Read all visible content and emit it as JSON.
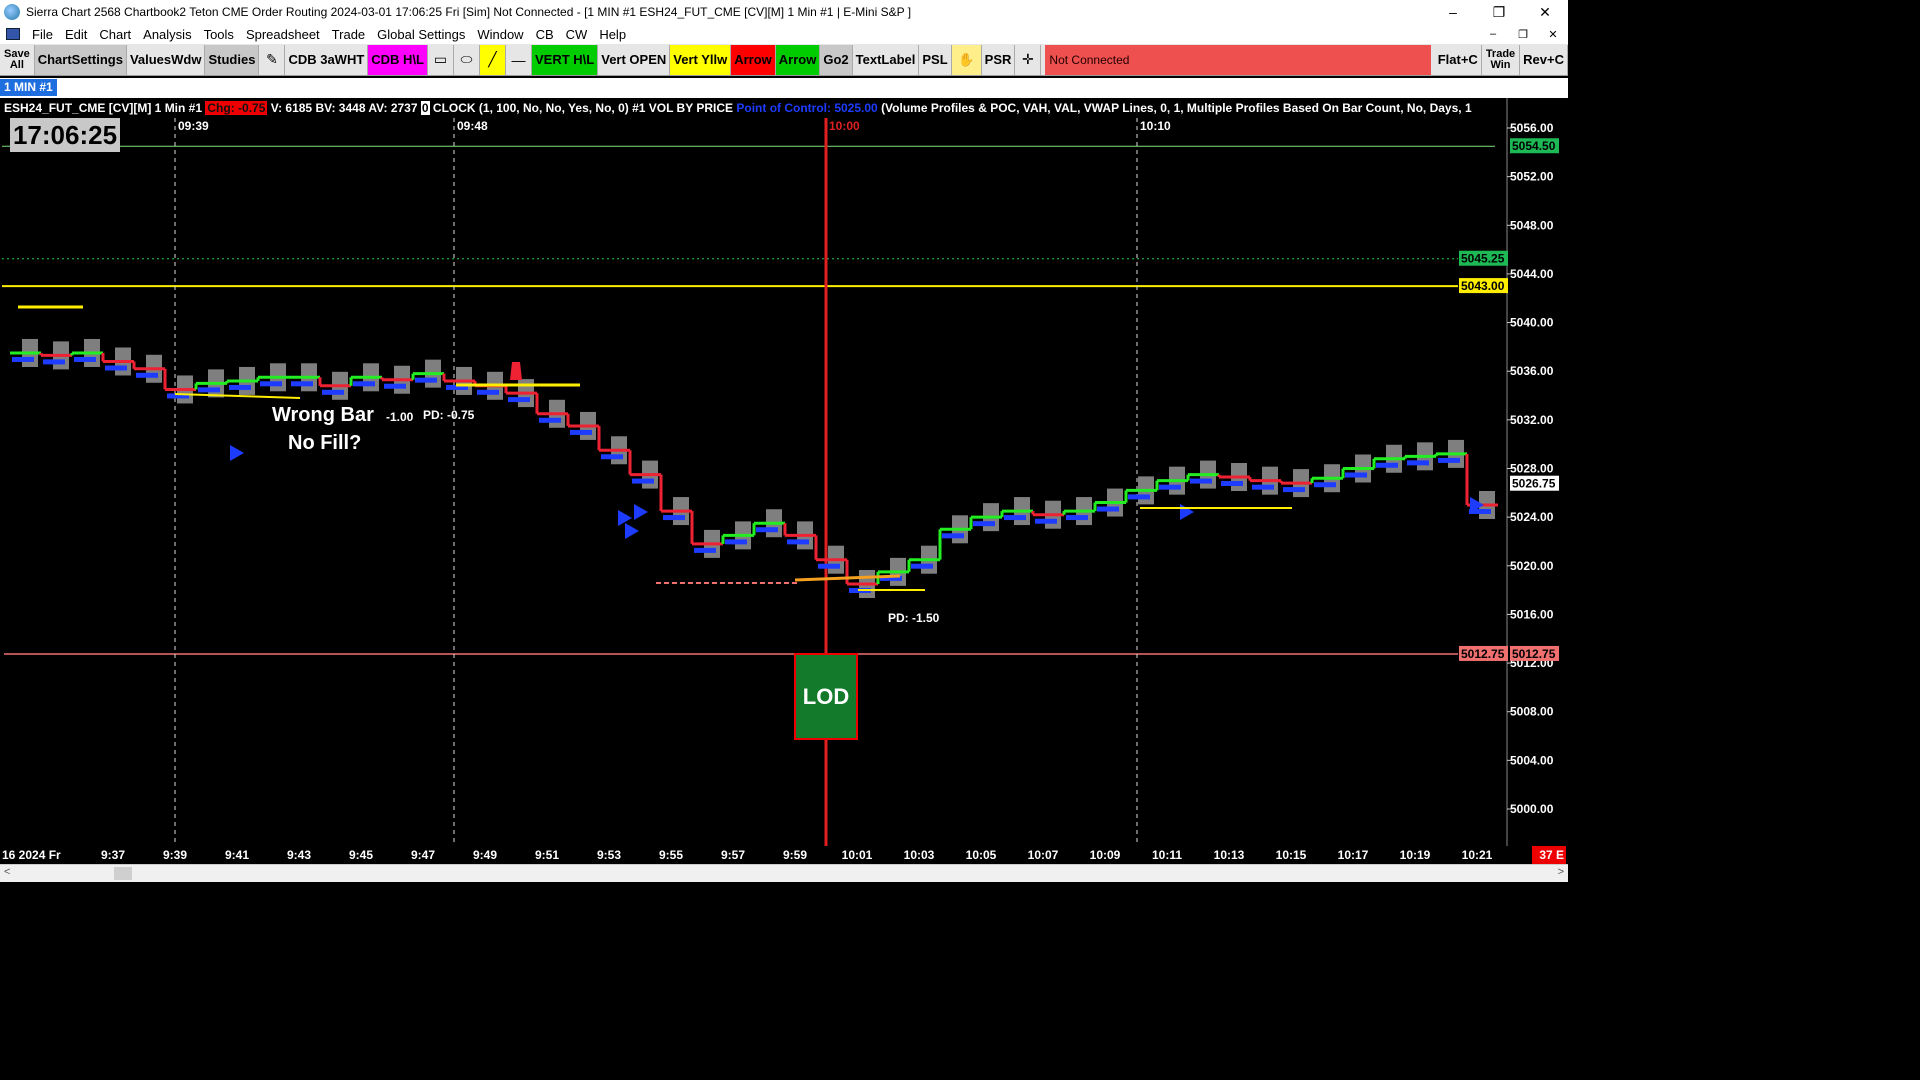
{
  "window": {
    "title": "Sierra Chart 2568 Chartbook2 Teton CME Order Routing 2024-03-01  17:06:25 Fri [Sim]  Not Connected - [1 MIN  #1 ESH24_FUT_CME [CV][M]  1 Min  #1 | E-Mini S&P ]",
    "minimize": "–",
    "maximize": "❐",
    "close": "✕"
  },
  "menu": {
    "items": [
      "File",
      "Edit",
      "Chart",
      "Analysis",
      "Tools",
      "Spreadsheet",
      "Trade",
      "Global Settings",
      "Window",
      "CB",
      "CW",
      "Help"
    ],
    "child_min": "–",
    "child_max": "❐",
    "child_close": "✕"
  },
  "toolbar": {
    "save_all_1": "Save",
    "save_all_2": "All",
    "chart_settings": "ChartSettings",
    "values_wdw": "ValuesWdw",
    "studies": "Studies",
    "draw_icon": "✎",
    "cdb_3awht": "CDB 3aWHT",
    "cdb_hl": "CDB H\\L",
    "rect_icon": "▭",
    "ellipse_icon": "⬭",
    "line_icon": "╱",
    "hline_icon": "—",
    "vert_hl": "VERT H\\L",
    "vert_open": "Vert OPEN",
    "vert_yllw": "Vert Yllw",
    "arrow_red": "Arrow",
    "arrow_green": "Arrow",
    "go2": "Go2",
    "text_label": "TextLabel",
    "psl": "PSL",
    "hand_icon": "✋",
    "psr": "PSR",
    "crosshair_icon": "✛",
    "status": "Not Connected",
    "flat_c": "Flat+C",
    "trade_win_1": "Trade",
    "trade_win_2": "Win",
    "rev_c": "Rev+C"
  },
  "tab": {
    "label": "1 MIN  #1"
  },
  "chart": {
    "symbol_info": "ESH24_FUT_CME [CV][M]   1 Min  #1",
    "chg_label": "Chg: -0.75",
    "volume": "V: 6185",
    "bid_volume": "BV: 3448",
    "ask_volume": "AV: 2737",
    "clock_num": "0",
    "clock_study": "CLOCK   (1, 100, No, No, Yes, No, 0)  #1 VOL BY PRICE",
    "poc": "Point of Control: 5025.00",
    "vbp_study": "(Volume Profiles & POC, VAH, VAL, VWAP Lines, 0, 1, Multiple Profiles Based On Bar Count, No, Days, 1",
    "clock": "17:06:25",
    "vline_labels": [
      "09:39",
      "09:48",
      "10:00",
      "10:10"
    ],
    "price_ticks": [
      "5056.00",
      "5052.00",
      "5048.00",
      "5044.00",
      "5040.00",
      "5036.00",
      "5032.00",
      "5028.00",
      "5024.00",
      "5020.00",
      "5016.00",
      "5012.00",
      "5008.00",
      "5004.00",
      "5000.00"
    ],
    "price_markers": [
      {
        "text": "5054.50",
        "color": "#1db954"
      },
      {
        "text": "5045.25",
        "color": "#1db954"
      },
      {
        "text": "5043.00",
        "color": "#ffee00"
      },
      {
        "text": "5026.75",
        "color": "#ffffff"
      },
      {
        "text": "5012.75",
        "color": "#f07070"
      },
      {
        "text": "5012.75",
        "color": "#f07070"
      }
    ],
    "annotations": {
      "wrong_bar": "Wrong Bar",
      "no_fill": "No Fill?",
      "pd1": "-1.00",
      "pd2": "PD: -0.75",
      "pd3": "PD: -1.50",
      "lod": "LOD"
    },
    "x_ticks": [
      "9:37",
      "9:39",
      "9:41",
      "9:43",
      "9:45",
      "9:47",
      "9:49",
      "9:51",
      "9:53",
      "9:55",
      "9:57",
      "9:59",
      "10:01",
      "10:03",
      "10:05",
      "10:07",
      "10:09",
      "10:11",
      "10:13",
      "10:15",
      "10:17",
      "10:19",
      "10:21"
    ],
    "date_label": "16 2024 Fr",
    "corner_label": "37 E"
  },
  "chart_data": {
    "type": "line",
    "title": "",
    "ylim": [
      4998,
      5058
    ],
    "x": [
      "9:34",
      "9:35",
      "9:36",
      "9:37",
      "9:38",
      "9:39",
      "9:40",
      "9:41",
      "9:42",
      "9:43",
      "9:44",
      "9:45",
      "9:46",
      "9:47",
      "9:48",
      "9:49",
      "9:50",
      "9:51",
      "9:52",
      "9:53",
      "9:54",
      "9:55",
      "9:56",
      "9:57",
      "9:58",
      "9:59",
      "10:00",
      "10:01",
      "10:02",
      "10:03",
      "10:04",
      "10:05",
      "10:06",
      "10:07",
      "10:08",
      "10:09",
      "10:10",
      "10:11",
      "10:12",
      "10:13",
      "10:14",
      "10:15",
      "10:16",
      "10:17",
      "10:18",
      "10:19",
      "10:20",
      "10:21"
    ],
    "series": [
      {
        "values": [
          5037.5,
          5037.3,
          5037.5,
          5036.8,
          5036.2,
          5034.5,
          5035,
          5035.2,
          5035.5,
          5035.5,
          5034.8,
          5035.5,
          5035.3,
          5035.8,
          5035.2,
          5034.8,
          5034.2,
          5032.5,
          5031.5,
          5029.5,
          5027.5,
          5024.5,
          5021.8,
          5022.5,
          5023.5,
          5022.5,
          5020.5,
          5018.5,
          5019.5,
          5020.5,
          5023,
          5024,
          5024.5,
          5024.2,
          5024.5,
          5025.2,
          5026.2,
          5027,
          5027.5,
          5027.3,
          5027,
          5026.8,
          5027.2,
          5028,
          5028.8,
          5029,
          5029.2,
          5025
        ]
      }
    ]
  },
  "colors": {
    "up": "#22ee22",
    "down": "#ee2233",
    "vwap_blue": "#1e3cff",
    "time_line": "#e02020",
    "lod_fill": "#127a2a"
  }
}
